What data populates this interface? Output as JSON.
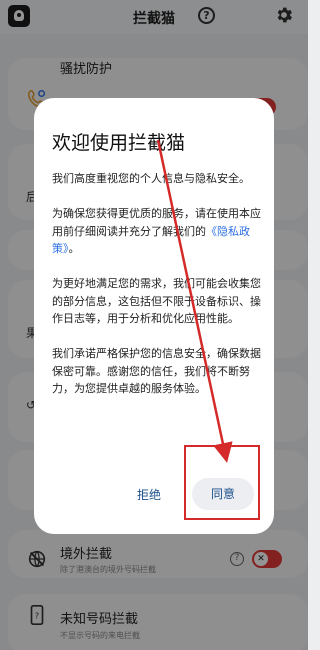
{
  "header": {
    "title": "拦截猫",
    "icons": [
      "app-logo-icon",
      "help-icon",
      "gear-icon"
    ]
  },
  "cards": [
    {
      "title": "骚扰防护",
      "icon": "phone-shield-icon"
    },
    {
      "title": "境外拦截",
      "subtitle": "除了港澳台的境外号码拦截",
      "icon": "globe-block-icon"
    },
    {
      "title": "未知号码拦截",
      "subtitle": "不显示号码的来电拦截",
      "icon": "phone-unknown-icon"
    }
  ],
  "fragments": [
    "后",
    "果",
    "↺"
  ],
  "dialog": {
    "title": "欢迎使用拦截猫",
    "para1": "我们高度重视您的个人信息与隐私安全。",
    "para2_pre": "为确保您获得更优质的服务，请在使用本应用前仔细阅读并充分了解我们的",
    "para2_link": "《隐私政策》",
    "para2_post": "。",
    "para3": "为更好地满足您的需求，我们可能会收集您的部分信息，这包括但不限于设备标识、操作日志等，用于分析和优化应用性能。",
    "para4": "我们承诺严格保护您的信息安全，确保数据保密可靠。感谢您的信任，我们将不断努力，为您提供卓越的服务体验。",
    "reject_label": "拒绝",
    "agree_label": "同意"
  },
  "colors": {
    "accent": "#e23a3a",
    "link": "#2d6fe0",
    "button_text": "#1a4f8a"
  }
}
